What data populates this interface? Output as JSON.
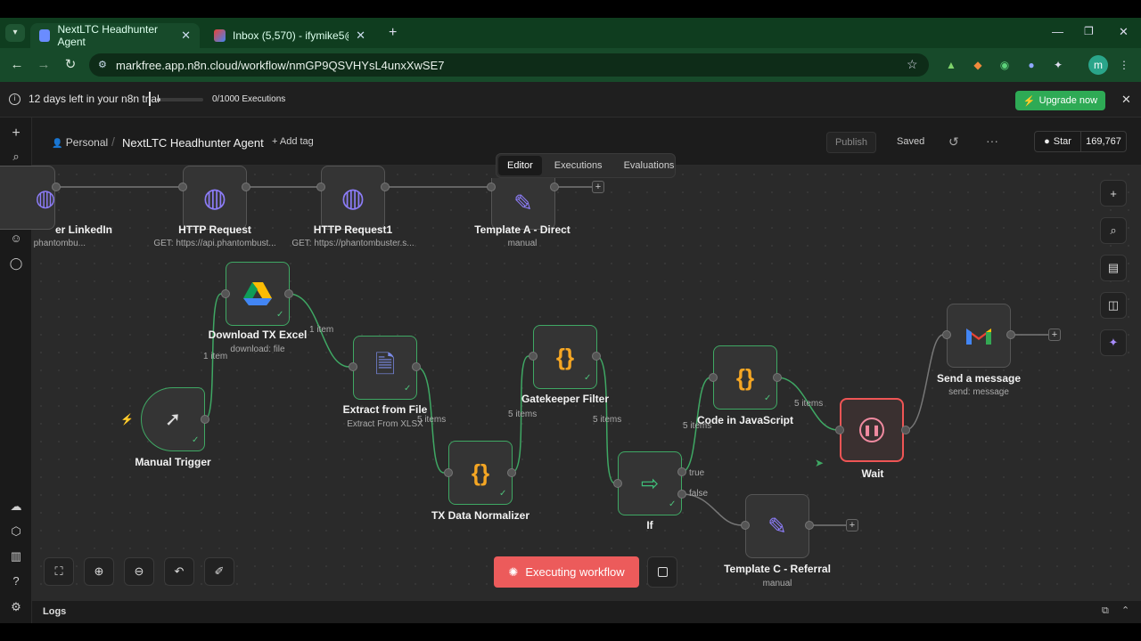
{
  "browser": {
    "tabs": [
      {
        "title": "NextLTC Headhunter Agent",
        "active": true
      },
      {
        "title": "Inbox (5,570) - ifymike5@gmail",
        "active": false
      }
    ],
    "url": "markfree.app.n8n.cloud/workflow/nmGP9QSVHYsL4unxXwSE7",
    "profile_initial": "m"
  },
  "banner": {
    "trial_text": "12 days left in your n8n trial",
    "executions_text": "0/1000 Executions",
    "executions_used_fraction": 0.0,
    "upgrade_label": "Upgrade now"
  },
  "header": {
    "personal": "Personal",
    "workflow_name": "NextLTC Headhunter Agent",
    "add_tag": "+ Add tag",
    "publish": "Publish",
    "saved": "Saved",
    "star_label": "Star",
    "star_count": "169,767"
  },
  "view_tabs": [
    "Editor",
    "Executions",
    "Evaluations"
  ],
  "nodes": {
    "linkedin": {
      "label": "er LinkedIn",
      "sub": "phantombu..."
    },
    "http1": {
      "label": "HTTP Request",
      "sub": "GET: https://api.phantombust..."
    },
    "http2": {
      "label": "HTTP Request1",
      "sub": "GET: https://phantombuster.s..."
    },
    "templateA": {
      "label": "Template A - Direct",
      "sub": "manual"
    },
    "download": {
      "label": "Download TX Excel",
      "sub": "download: file"
    },
    "extract": {
      "label": "Extract from File",
      "sub": "Extract From XLSX"
    },
    "gatekeeper": {
      "label": "Gatekeeper Filter",
      "sub": ""
    },
    "normalizer": {
      "label": "TX Data Normalizer",
      "sub": ""
    },
    "trigger": {
      "label": "Manual Trigger",
      "sub": ""
    },
    "if": {
      "label": "If",
      "sub": ""
    },
    "code": {
      "label": "Code in JavaScript",
      "sub": ""
    },
    "wait": {
      "label": "Wait",
      "sub": ""
    },
    "gmail": {
      "label": "Send a message",
      "sub": "send: message"
    },
    "templateC": {
      "label": "Template C - Referral",
      "sub": "manual"
    }
  },
  "edge_labels": {
    "trigger_download": "1 item",
    "download_extract": "1 item",
    "extract_normalizer": "5 items",
    "normalizer_gatekeeper": "5 items",
    "gatekeeper_if": "5 items",
    "if_code": "5 items",
    "code_wait": "5 items",
    "if_true": "true",
    "if_false": "false"
  },
  "controls": {
    "executing": "Executing workflow",
    "logs": "Logs"
  },
  "colors": {
    "success": "#3fa864",
    "execute": "#ec5b5b",
    "upgrade": "#2eaa55"
  }
}
